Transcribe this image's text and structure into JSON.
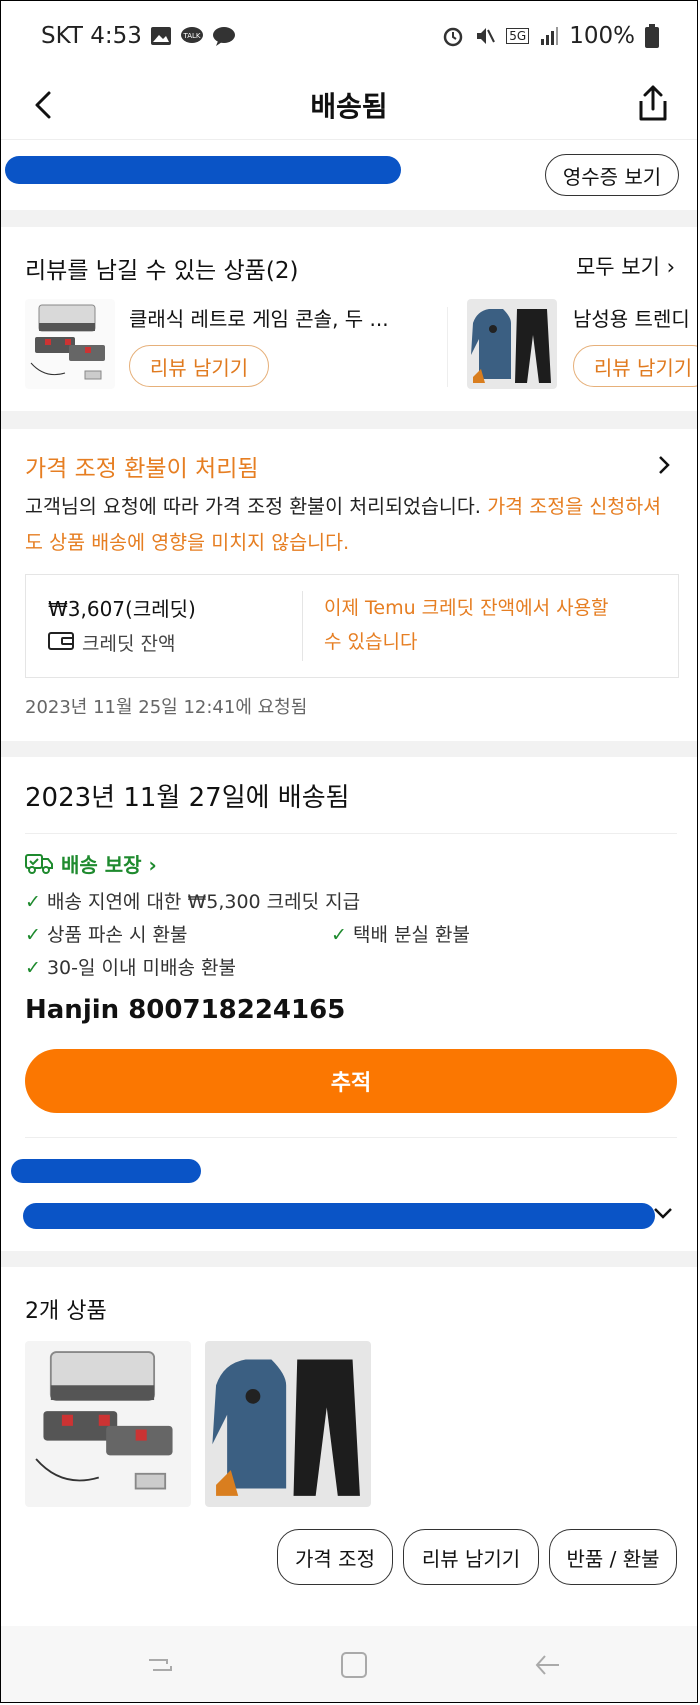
{
  "status_bar": {
    "carrier_time": "SKT 4:53",
    "battery": "100%",
    "network": "5G"
  },
  "header": {
    "title": "배송됨"
  },
  "order": {
    "receipt_label": "영수증 보기"
  },
  "reviews": {
    "title": "리뷰를 남길 수 있는 상품(2)",
    "see_all": "모두 보기 ›",
    "items": [
      {
        "name": "클래식 레트로 게임 콘솔, 두 ...",
        "button": "리뷰 남기기"
      },
      {
        "name": "남성용 트렌디",
        "button": "리뷰 남기기"
      }
    ]
  },
  "refund": {
    "title": "가격 조정 환불이 처리됨",
    "desc_black": "고객님의 요청에 따라 가격 조정 환불이 처리되었습니다.",
    "desc_orange_1": " 가격 조정",
    "desc_orange_2": "을 신청하셔도 상품 배송에 영향을 미치지 않습니다.",
    "amount": "₩3,607(크레딧)",
    "balance_label": "크레딧 잔액",
    "note_line1": "이제 Temu 크레딧 잔액에서 사용할",
    "note_line2": "수 있습니다",
    "requested_at": "2023년 11월 25일 12:41에 요청됨"
  },
  "delivery": {
    "title": "2023년 11월 27일에 배송됨",
    "guarantee_label": "배송 보장 ›",
    "guarantees": [
      "배송 지연에 대한 ₩5,300 크레딧 지급",
      "상품 파손 시 환불",
      "택배 분실 환불",
      "30-일 이내 미배송 환불"
    ],
    "tracking": "Hanjin 800718224165",
    "track_button": "추적"
  },
  "items": {
    "title": "2개 상품",
    "buttons": [
      "가격 조정",
      "리뷰 남기기",
      "반품 / 환불"
    ]
  },
  "colors": {
    "accent": "#fb7701",
    "orange_text": "#e67e22",
    "green": "#1e8a2e",
    "redaction": "#0a54c6"
  }
}
